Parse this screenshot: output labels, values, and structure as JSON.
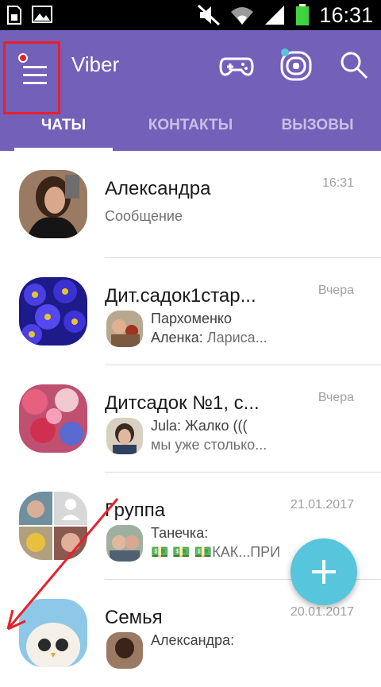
{
  "status_bar": {
    "time": "16:31",
    "icons": [
      "sim-icon",
      "image-icon",
      "mute-icon",
      "wifi-icon",
      "signal-icon",
      "battery-icon"
    ]
  },
  "appbar": {
    "title": "Viber",
    "accent": "#7360b8",
    "icons": [
      "menu-icon",
      "gamepad-icon",
      "stickers-icon",
      "search-icon"
    ]
  },
  "tabs": [
    {
      "label": "ЧАТЫ",
      "active": true
    },
    {
      "label": "КОНТАКТЫ",
      "active": false
    },
    {
      "label": "ВЫЗОВЫ",
      "active": false
    }
  ],
  "chats": [
    {
      "name": "Александра",
      "time": "16:31",
      "preview": "Сообщение"
    },
    {
      "name": "Дит.садок1стар...",
      "time": "Вчера",
      "sender": "Пархоменко",
      "line2_sender": "Аленка:",
      "line2_text": " Лариса..."
    },
    {
      "name": "Дитсадок №1, с...",
      "time": "Вчера",
      "line1_sender": "Jula:",
      "line1_text": " Жалко (((",
      "line2_text": "мы уже столько..."
    },
    {
      "name": "Группа",
      "time": "21.01.2017",
      "line1_sender": "Танечка:",
      "line2_text": "💵 💵 💵КАК...ПРИ"
    },
    {
      "name": "Семья",
      "time": "20.01.2017",
      "line1_sender": "Александра:"
    }
  ],
  "fab": {
    "icon": "plus-icon",
    "color": "#57c6dd"
  }
}
